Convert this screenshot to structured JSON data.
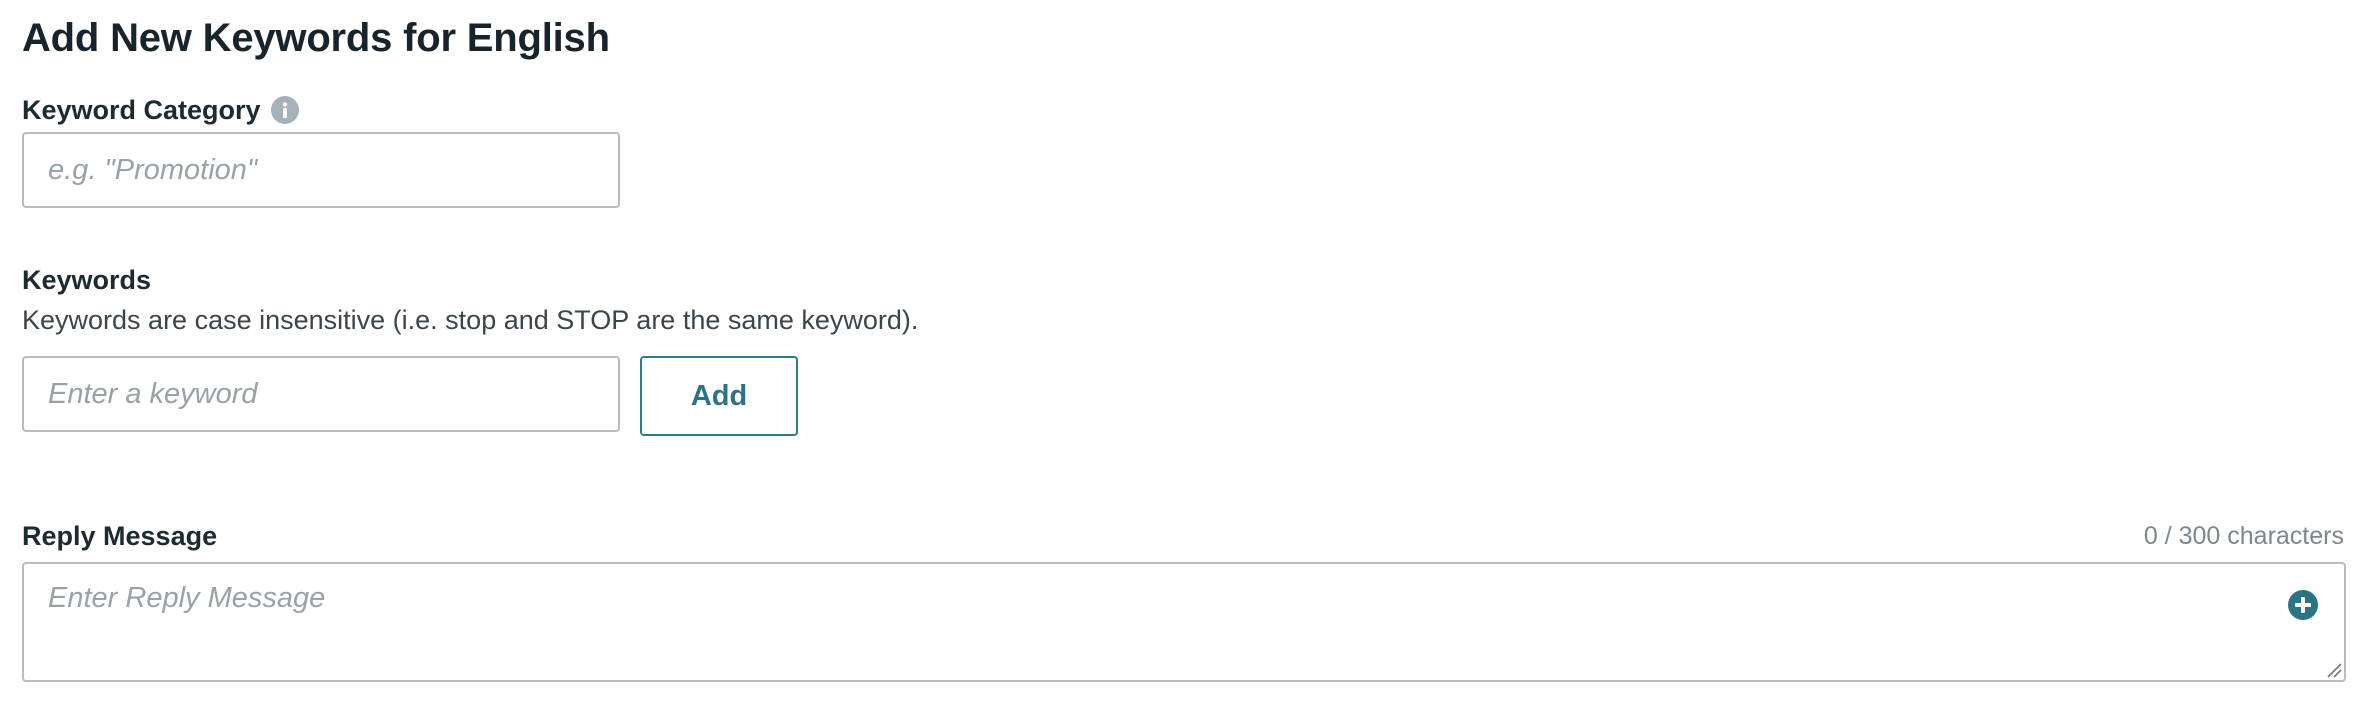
{
  "page": {
    "title": "Add New Keywords for English"
  },
  "keyword_category": {
    "label": "Keyword Category",
    "info_icon": "info-icon",
    "placeholder": "e.g. \"Promotion\"",
    "value": ""
  },
  "keywords": {
    "label": "Keywords",
    "helper": "Keywords are case insensitive (i.e. stop and STOP are the same keyword).",
    "placeholder": "Enter a keyword",
    "value": "",
    "add_label": "Add"
  },
  "reply_message": {
    "label": "Reply Message",
    "counter": "0 / 300 characters",
    "placeholder": "Enter Reply Message",
    "value": "",
    "insert_icon": "plus-circle-icon"
  },
  "colors": {
    "accent": "#2e7b8c",
    "input_border": "#b8bdc1",
    "placeholder": "#98a2a8",
    "info_icon": "#a7b1b8"
  }
}
